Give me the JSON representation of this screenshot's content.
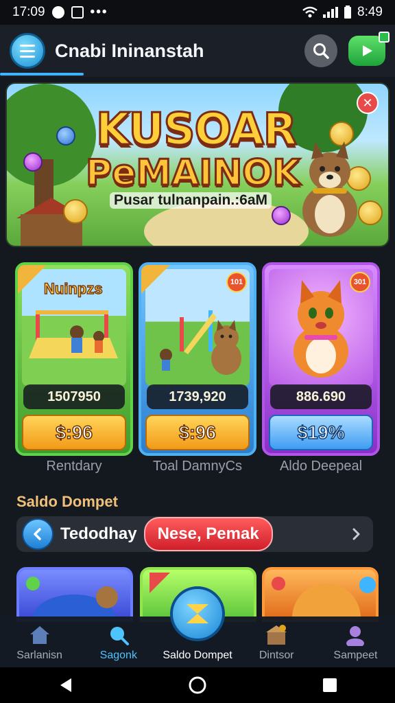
{
  "status_bar": {
    "time_left": "17:09",
    "time_right": "8:49"
  },
  "header": {
    "title": "Cnabi Ininanstah"
  },
  "banner": {
    "title_line1": "KUSOAR",
    "title_line2": "PeMAINOK",
    "subtitle": "Pusar tulnanpain.:6aM",
    "close_label": "✕"
  },
  "cards": [
    {
      "label": "Nuinpzs",
      "score": "1507950",
      "price": "$:96",
      "caption": "Rentdary",
      "badge": ""
    },
    {
      "label": "",
      "score": "1739,920",
      "price": "$:96",
      "caption": "Toal DamnyCs",
      "badge": "101"
    },
    {
      "label": "",
      "score": "886.690",
      "price": "$19%",
      "caption": "Aldo Deepeal",
      "badge": "301"
    }
  ],
  "section": {
    "title": "Saldo Dompet",
    "filter_text": "Tedodhay",
    "chip_label": "Nese, Pemak"
  },
  "bottom_nav": {
    "items": [
      {
        "label": "Sarlanisn"
      },
      {
        "label": "Sagonk"
      },
      {
        "label": "Saldo Dompet"
      },
      {
        "label": "Dintsor"
      },
      {
        "label": "Sampeet"
      }
    ],
    "active_index": 1
  },
  "colors": {
    "accent": "#3fb4ff",
    "chip": "#e0262f",
    "section_title": "#f0c07a",
    "background": "#14181f"
  },
  "icons": {
    "menu": "hamburger-icon",
    "search": "search-icon",
    "play": "play-icon",
    "back": "chevron-left-icon",
    "next": "chevron-right-icon",
    "fab": "star-icon"
  }
}
